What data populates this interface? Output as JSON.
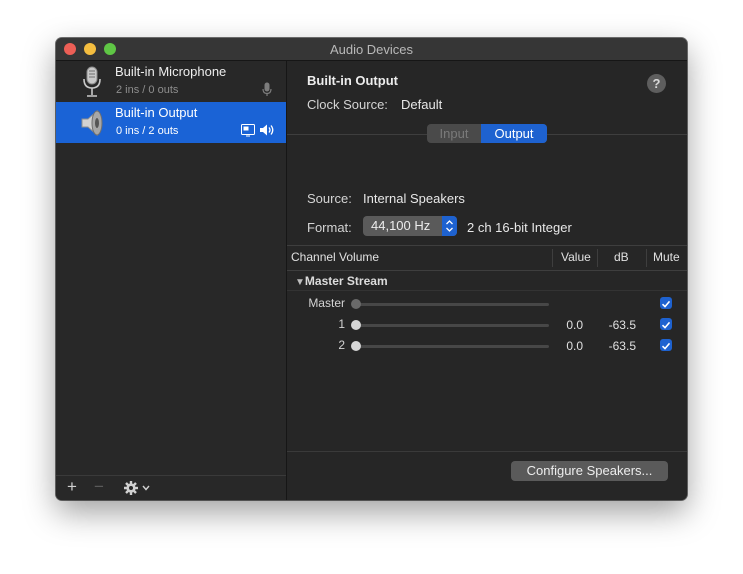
{
  "window": {
    "title": "Audio Devices"
  },
  "sidebar": {
    "devices": [
      {
        "name": "Built-in Microphone",
        "io": "2 ins / 0 outs",
        "icon": "microphone-icon",
        "aux_icon": "mic-input-icon",
        "selected": false
      },
      {
        "name": "Built-in Output",
        "io": "0 ins / 2 outs",
        "icon": "speaker-icon",
        "aux_icons": [
          "display-icon",
          "volume-icon"
        ],
        "selected": true
      }
    ],
    "bottom": {
      "add": "+",
      "remove": "−",
      "gear": "gear-icon",
      "chevron": "chevron-down-icon"
    }
  },
  "main": {
    "device_title": "Built-in Output",
    "help": "?",
    "clock_source_label": "Clock Source:",
    "clock_source_value": "Default",
    "tabs": [
      {
        "label": "Input",
        "active": false
      },
      {
        "label": "Output",
        "active": true
      }
    ],
    "source_label": "Source:",
    "source_value": "Internal Speakers",
    "format_label": "Format:",
    "format_value": "44,100 Hz",
    "format_detail": "2 ch 16-bit Integer"
  },
  "table": {
    "headers": {
      "channel": "Channel Volume",
      "value": "Value",
      "db": "dB",
      "mute": "Mute"
    },
    "group": "Master Stream",
    "rows": [
      {
        "label": "Master",
        "value": "",
        "db": "",
        "muted": true,
        "slider_level": 0
      },
      {
        "label": "1",
        "value": "0.0",
        "db": "-63.5",
        "muted": true,
        "slider_level": 0
      },
      {
        "label": "2",
        "value": "0.0",
        "db": "-63.5",
        "muted": true,
        "slider_level": 0
      }
    ]
  },
  "footer": {
    "configure_label": "Configure Speakers..."
  },
  "colors": {
    "accent": "#1e62d0",
    "selection": "#1a63d6",
    "window_bg": "#262626"
  }
}
